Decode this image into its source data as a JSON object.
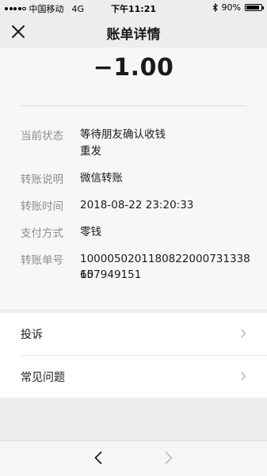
{
  "status_bar": {
    "carrier": "中国移动",
    "network": "4G",
    "time": "下午11:21",
    "battery": "90%",
    "battery_level": 0.9
  },
  "nav": {
    "title": "账单详情",
    "close_icon": "close-icon"
  },
  "amount": "−1.00",
  "details": {
    "status": {
      "label": "当前状态",
      "value": "等待朋友确认收钱",
      "action": "重发"
    },
    "note": {
      "label": "转账说明",
      "value": "微信转账"
    },
    "time": {
      "label": "转账时间",
      "value": "2018-08-22 23:20:33"
    },
    "payment": {
      "label": "支付方式",
      "value": "零钱"
    },
    "order": {
      "label": "转账单号",
      "value_line1": "1000050201180822000731338 10",
      "value_line2": "657949151"
    }
  },
  "menu": {
    "complaint": "投诉",
    "faq": "常见问题"
  },
  "colors": {
    "link": "#576b95",
    "label": "#8c8c8c"
  }
}
